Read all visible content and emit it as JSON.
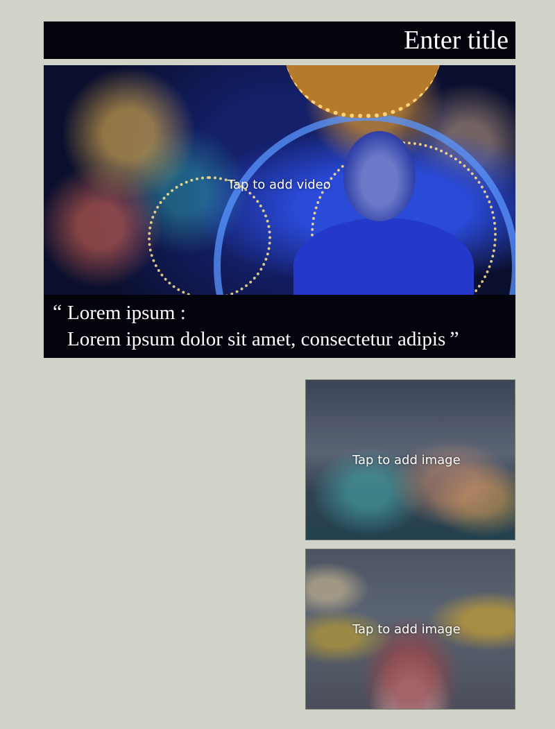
{
  "header": {
    "title": "Enter title"
  },
  "video": {
    "label": "Tap to add video"
  },
  "caption": {
    "open_quote": "“",
    "line1": "Lorem ipsum :",
    "line2": "Lorem ipsum dolor sit amet, consectetur adipis",
    "close_quote": "”"
  },
  "images": [
    {
      "label": "Tap to add image"
    },
    {
      "label": "Tap to add image"
    }
  ],
  "colors": {
    "background": "#d1d3c8",
    "bar": "#03040b",
    "text": "#ffffff"
  }
}
